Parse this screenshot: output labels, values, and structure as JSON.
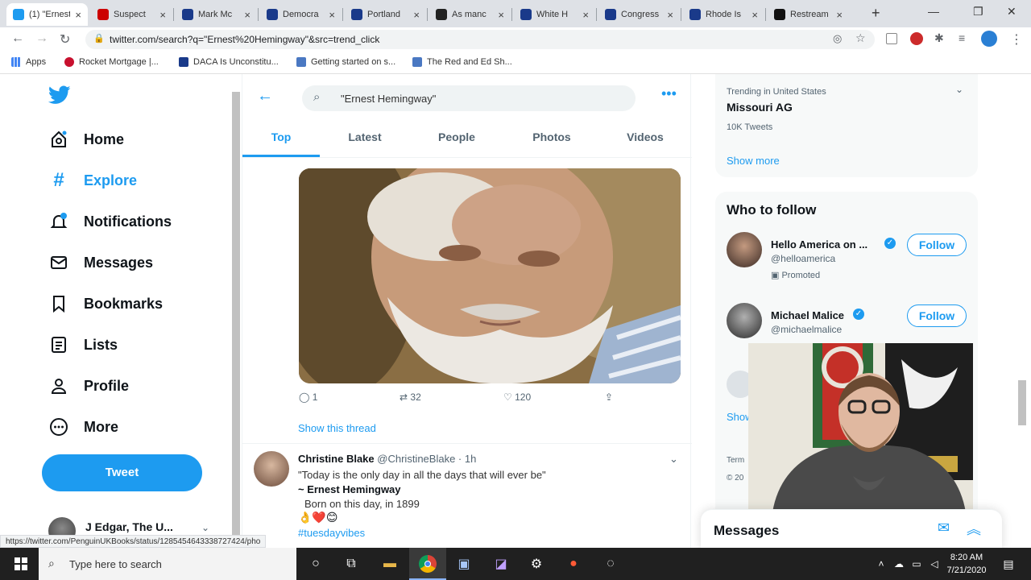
{
  "browser": {
    "tabs": [
      {
        "title": "(1) \"Ernest",
        "color": "#1d9bf0",
        "active": true
      },
      {
        "title": "Suspect",
        "color": "#cc0000"
      },
      {
        "title": "Mark Mc",
        "color": "#1a3a8a"
      },
      {
        "title": "Democra",
        "color": "#1a3a8a"
      },
      {
        "title": "Portland",
        "color": "#1a3a8a"
      },
      {
        "title": "As manc",
        "color": "#222222"
      },
      {
        "title": "White H",
        "color": "#1a3a8a"
      },
      {
        "title": "Congress",
        "color": "#1a3a8a"
      },
      {
        "title": "Rhode Is",
        "color": "#1a3a8a"
      },
      {
        "title": "Restream",
        "color": "#111111"
      }
    ],
    "url": "twitter.com/search?q=\"Ernest%20Hemingway\"&src=trend_click",
    "bookmarks": [
      {
        "label": "Apps"
      },
      {
        "label": "Rocket Mortgage |..."
      },
      {
        "label": "DACA Is Unconstitu..."
      },
      {
        "label": "Getting started on s..."
      },
      {
        "label": "The Red and Ed Sh..."
      }
    ],
    "status_url": "https://twitter.com/PenguinUKBooks/status/1285454643338727424/pho"
  },
  "sidebar": {
    "items": [
      {
        "label": "Home",
        "icon": "home-icon"
      },
      {
        "label": "Explore",
        "icon": "hashtag-icon",
        "active": true
      },
      {
        "label": "Notifications",
        "icon": "bell-icon"
      },
      {
        "label": "Messages",
        "icon": "mail-icon"
      },
      {
        "label": "Bookmarks",
        "icon": "bookmark-icon"
      },
      {
        "label": "Lists",
        "icon": "list-icon"
      },
      {
        "label": "Profile",
        "icon": "person-icon"
      },
      {
        "label": "More",
        "icon": "more-icon"
      }
    ],
    "tweet_button": "Tweet",
    "account_name": "J Edgar, The U..."
  },
  "search": {
    "query": "\"Ernest Hemingway\"",
    "tabs": [
      "Top",
      "Latest",
      "People",
      "Photos",
      "Videos"
    ],
    "active_tab": "Top"
  },
  "tweet1": {
    "replies": "1",
    "retweets": "32",
    "likes": "120",
    "show_thread": "Show this thread"
  },
  "tweet2": {
    "name": "Christine Blake",
    "handle": "@ChristineBlake",
    "time": "· 1h",
    "line1": "\"Today is the only day in all the days that will ever be\"",
    "line2": "~ Ernest Hemingway",
    "line3": "Born on this day, in 1899",
    "emoji": "👌❤️😊",
    "hashtag": "#tuesdayvibes"
  },
  "trending": {
    "context": "Trending in United States",
    "topic": "Missouri AG",
    "count": "10K Tweets",
    "show_more": "Show more"
  },
  "who_to_follow": {
    "title": "Who to follow",
    "accounts": [
      {
        "name": "Hello America on ...",
        "handle": "@helloamerica",
        "promoted": "Promoted",
        "button": "Follow"
      },
      {
        "name": "Michael Malice",
        "handle": "@michaelmalice",
        "button": "Follow"
      }
    ],
    "partial_show": "Show",
    "partial_terms": "Term",
    "partial_copyright": "© 20"
  },
  "messages_dock": {
    "title": "Messages"
  },
  "taskbar": {
    "search_placeholder": "Type here to search",
    "time": "8:20 AM",
    "date": "7/21/2020"
  }
}
